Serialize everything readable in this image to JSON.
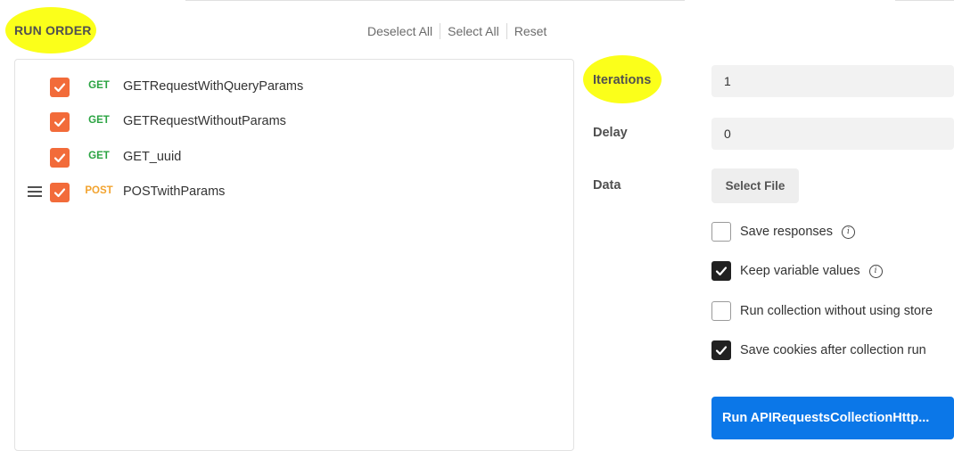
{
  "header": {
    "run_order_label": "RUN ORDER"
  },
  "toolbar": {
    "deselect_all": "Deselect All",
    "select_all": "Select All",
    "reset": "Reset"
  },
  "requests": [
    {
      "method": "GET",
      "name": "GETRequestWithQueryParams",
      "checked": true
    },
    {
      "method": "GET",
      "name": "GETRequestWithoutParams",
      "checked": true
    },
    {
      "method": "GET",
      "name": "GET_uuid",
      "checked": true
    },
    {
      "method": "POST",
      "name": "POSTwithParams",
      "checked": true
    }
  ],
  "settings": {
    "iterations_label": "Iterations",
    "iterations_value": "1",
    "delay_label": "Delay",
    "delay_value": "0",
    "data_label": "Data",
    "select_file": "Select File"
  },
  "options": [
    {
      "label": "Save responses",
      "checked": false,
      "info": true
    },
    {
      "label": "Keep variable values",
      "checked": true,
      "info": true
    },
    {
      "label": "Run collection without using store",
      "checked": false,
      "info": false
    },
    {
      "label": "Save cookies after collection run",
      "checked": true,
      "info": false
    }
  ],
  "run_button": {
    "label": "Run APIRequestsCollectionHttp..."
  },
  "colors": {
    "checkbox_orange": "#f26b3a",
    "get_green": "#2aa342",
    "post_orange": "#f2a32e",
    "run_blue": "#0b77e8",
    "highlight_yellow": "#fbff1a"
  }
}
